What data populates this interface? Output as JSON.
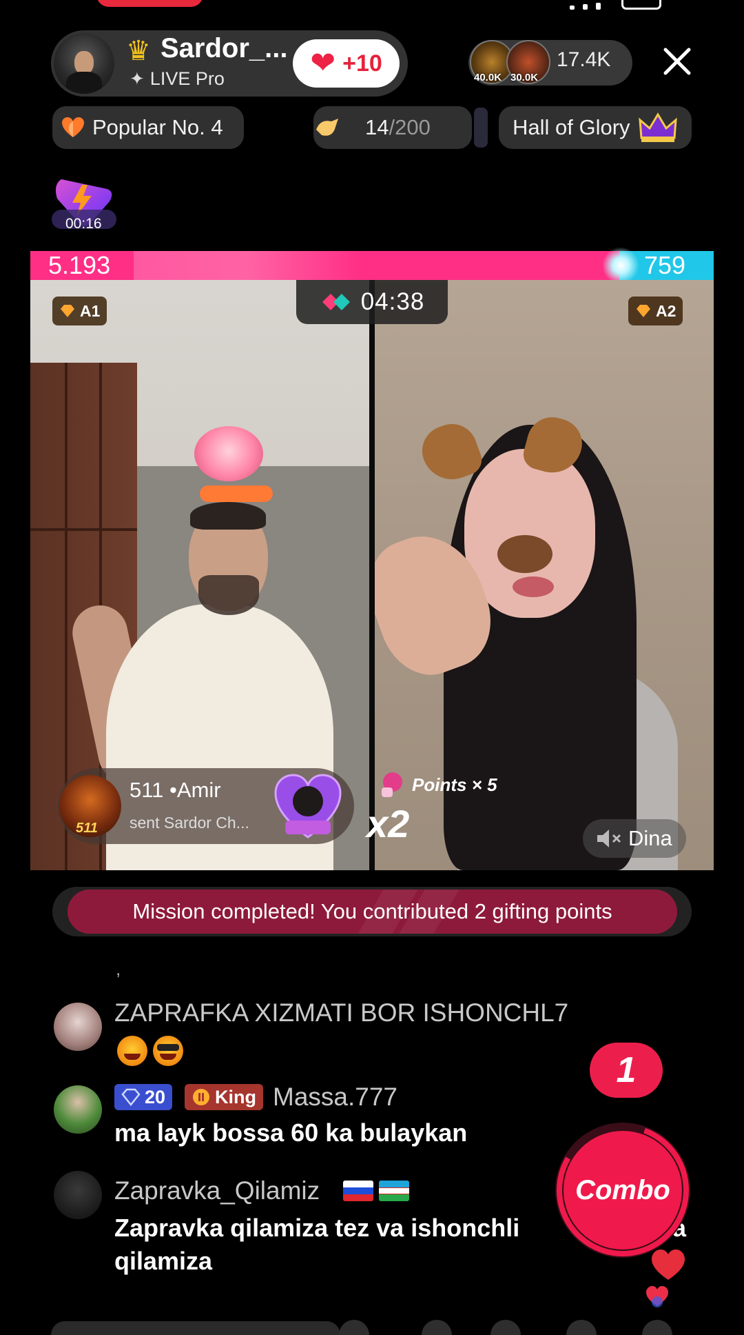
{
  "host": {
    "name": "Sardor_...",
    "subtitle": "LIVE Pro",
    "like_label": "+10"
  },
  "viewers": {
    "top1_amount": "40.0K",
    "top2_amount": "30.0K",
    "count": "17.4K"
  },
  "chips": {
    "popular": "Popular No. 4",
    "progress_current": "14",
    "progress_total": "/200",
    "glory": "Hall of Glory"
  },
  "bolt_timer": "00:16",
  "battle": {
    "left_score": "5.193",
    "right_score": "759",
    "timer": "04:38",
    "left_badge": "A1",
    "right_badge": "A2",
    "right_name": "Dina",
    "points": "Points × 5",
    "multiplier": "x2"
  },
  "gift_notice": {
    "level": "511",
    "sender": "511 •Amir",
    "text": "sent Sardor Ch..."
  },
  "mission_text": "Mission completed! You contributed 2 gifting points",
  "chat": [
    {
      "user": "ZAPRAFKA XIZMATI BOR ISHONCHL7",
      "message": ""
    },
    {
      "user": "Massa.777",
      "badge_level": "20",
      "badge_rank": "King",
      "message": "ma layk bossa 60 ka bulaykan"
    },
    {
      "user": "Zapravka_Qilamiz",
      "message_line1": "Zapravka qilamiza tez va ishonchli",
      "message_line2": "qilamiza",
      "message_tail": "a"
    }
  ],
  "chat_partial": ",",
  "combo": {
    "count": "1",
    "label": "Combo"
  },
  "colors": {
    "accent_pink": "#ff2f86",
    "accent_cyan": "#21c7e8",
    "combo_red": "#f0194b",
    "mission_bg": "#8e1a3b"
  },
  "icons": [
    "close-icon",
    "heart-icon",
    "crown-icon",
    "sparkle-icon",
    "bolt-icon",
    "gem-icon",
    "boxing-glove-icon",
    "mute-icon",
    "orange-heart-icon"
  ]
}
